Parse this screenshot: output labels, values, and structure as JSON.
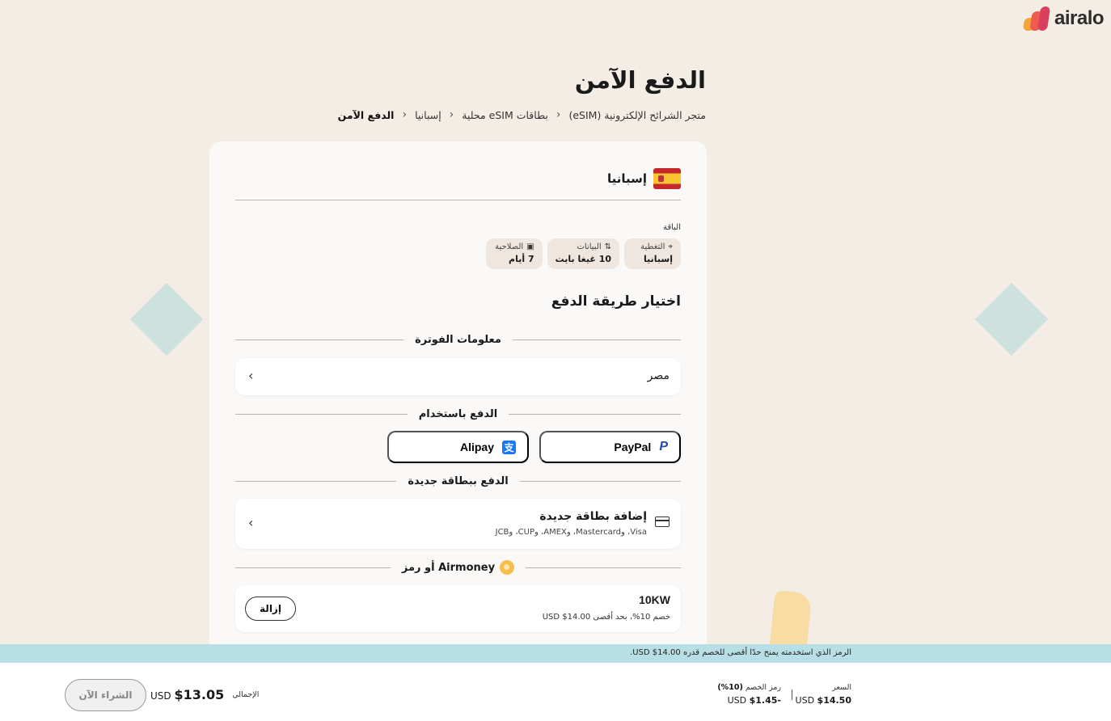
{
  "brand": {
    "name": "airalo"
  },
  "page": {
    "title": "الدفع الآمن",
    "breadcrumb": [
      "متجر الشرائح الإلكترونية (eSIM)",
      "بطاقات eSIM محلية",
      "إسبانيا",
      "الدفع الآمن"
    ]
  },
  "package": {
    "country": "إسبانيا",
    "plan_label": "الباقة",
    "chips": [
      {
        "label": "التغطية",
        "value": "إسبانيا",
        "icon": "location-pin-icon"
      },
      {
        "label": "البيانات",
        "value": "10 غيغا بايت",
        "icon": "data-arrows-icon"
      },
      {
        "label": "الصلاحية",
        "value": "7 أيام",
        "icon": "calendar-icon"
      }
    ]
  },
  "payment": {
    "section_title": "اختيار طريقة الدفع",
    "billing_heading": "معلومات الفوترة",
    "billing_country": "مصر",
    "pay_with_heading": "الدفع باستخدام",
    "methods": [
      {
        "label": "PayPal",
        "icon": "paypal-icon"
      },
      {
        "label": "Alipay",
        "icon": "alipay-icon"
      }
    ],
    "new_card_heading": "الدفع ببطاقة جديدة",
    "new_card_title": "إضافة بطاقة جديدة",
    "new_card_brands": "Visa، وMastercard، وAMEX، وCUP، وJCB",
    "airmoney_heading": "Airmoney أو رمز",
    "promo_code": "10KW",
    "promo_desc": "خصم 10%، بحد أقصى 14.00$ USD",
    "remove_label": "إزالة"
  },
  "notice": "الرمز الذي استخدمته يمنح حدًا أقصى للخصم قدره 14.00$ USD.",
  "footer": {
    "price_label": "السعر",
    "price_value": "$14.50",
    "currency": "USD",
    "discount_label": "رمز الخصم",
    "discount_pct": "(10%)",
    "discount_value": "-$1.45",
    "total_label": "الإجمالي",
    "total_value": "$13.05",
    "buy_label": "الشراء الآن"
  },
  "colors": {
    "background": "#f4ede6",
    "card": "#fbf9f7",
    "notice": "#b8dfe5",
    "paypal": "#1d4ba8",
    "alipay": "#1677ff",
    "logo": [
      "#f6a53a",
      "#ef5b4c",
      "#d8405d"
    ]
  }
}
